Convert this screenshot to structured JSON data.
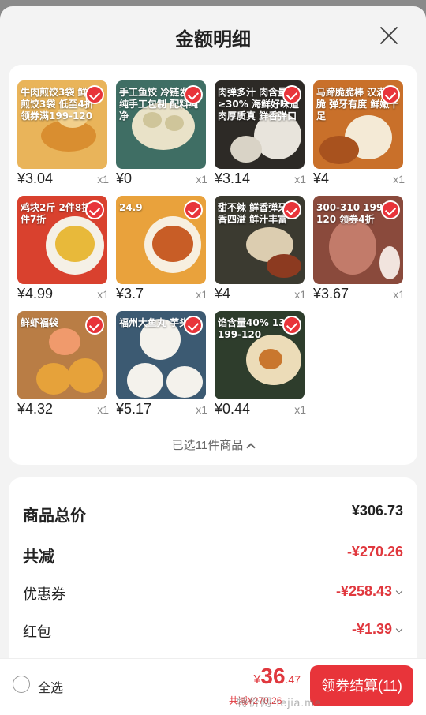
{
  "header": {
    "title": "金额明细"
  },
  "products": [
    {
      "price": "¥3.04",
      "qty": "x1",
      "thumb_text": "牛肉煎饺3袋 鲜肉煎饺3袋 低至4折 领券满199-120",
      "bg": "#e9b45a"
    },
    {
      "price": "¥0",
      "qty": "x1",
      "thumb_text": "手工鱼饺 冷链发货 纯手工包制 配料纯净",
      "bg": "#3f6e64"
    },
    {
      "price": "¥3.14",
      "qty": "x1",
      "thumb_text": "肉弹多汁 肉含量≥30% 海鲜好味道 肉厚质真 鲜香弹口",
      "bg": "#2d2a26"
    },
    {
      "price": "¥4",
      "qty": "x1",
      "thumb_text": "马蹄脆脆棒 汉满鱼脆 弹牙有度 鲜嫩十足",
      "bg": "#c9702a"
    },
    {
      "price": "¥4.99",
      "qty": "x1",
      "thumb_text": "鸡块2斤 2件8折 3件7折",
      "bg": "#d9412e"
    },
    {
      "price": "¥3.7",
      "qty": "x1",
      "thumb_text": "24.9",
      "bg": "#e9a23c"
    },
    {
      "price": "¥4",
      "qty": "x1",
      "thumb_text": "甜不辣 鲜香弹牙 肉香四溢 鲜汁丰富",
      "bg": "#3b3a30"
    },
    {
      "price": "¥3.67",
      "qty": "x1",
      "thumb_text": "300-310 199减120 领券4折",
      "bg": "#8a4a3c"
    },
    {
      "price": "¥4.32",
      "qty": "x1",
      "thumb_text": "鲜虾福袋",
      "bg": "#b97d45"
    },
    {
      "price": "¥5.17",
      "qty": "x1",
      "thumb_text": "福州大鱼丸 芋头馅",
      "bg": "#3c5a72"
    },
    {
      "price": "¥0.44",
      "qty": "x1",
      "thumb_text": "馅含量40% 13.9 199-120",
      "bg": "#2e3d2c"
    }
  ],
  "selected_text": "已选11件商品",
  "summary": {
    "total_label": "商品总价",
    "total_value": "¥306.73",
    "reduce_label": "共减",
    "reduce_value": "-¥270.26",
    "coupon_label": "优惠券",
    "coupon_value": "-¥258.43",
    "redpacket_label": "红包",
    "redpacket_value": "-¥1.39"
  },
  "bottom": {
    "select_all": "全选",
    "currency": "¥",
    "price_int": "36",
    "price_dec": ".47",
    "discount_note": "共减¥270.26",
    "checkout_label": "领券结算(11)"
  },
  "watermark": "特价网·tejia.me",
  "colors": {
    "accent": "#e8343a",
    "price_red": "#e0383e"
  }
}
